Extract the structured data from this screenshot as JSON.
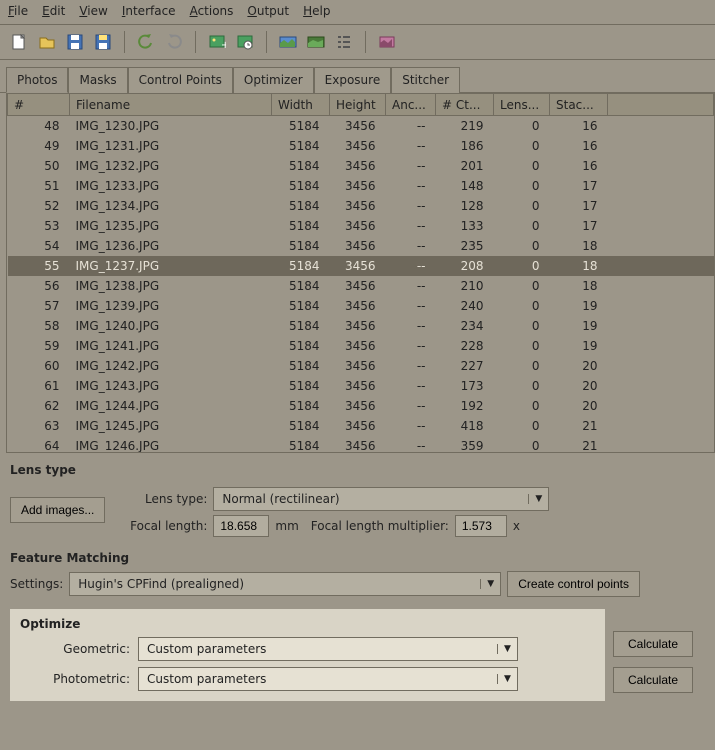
{
  "menu": {
    "file": "File",
    "edit": "Edit",
    "view": "View",
    "interface": "Interface",
    "actions": "Actions",
    "output": "Output",
    "help": "Help"
  },
  "tabs": {
    "photos": "Photos",
    "masks": "Masks",
    "controlpoints": "Control Points",
    "optimizer": "Optimizer",
    "exposure": "Exposure",
    "stitcher": "Stitcher"
  },
  "columns": {
    "num": "#",
    "filename": "Filename",
    "width": "Width",
    "height": "Height",
    "anc": "Anc...",
    "ct": "#  Ct...",
    "lens": "Lens...",
    "stac": "Stac..."
  },
  "rows": [
    {
      "n": "48",
      "f": "IMG_1230.JPG",
      "w": "5184",
      "h": "3456",
      "a": "--",
      "c": "219",
      "l": "0",
      "s": "16"
    },
    {
      "n": "49",
      "f": "IMG_1231.JPG",
      "w": "5184",
      "h": "3456",
      "a": "--",
      "c": "186",
      "l": "0",
      "s": "16"
    },
    {
      "n": "50",
      "f": "IMG_1232.JPG",
      "w": "5184",
      "h": "3456",
      "a": "--",
      "c": "201",
      "l": "0",
      "s": "16"
    },
    {
      "n": "51",
      "f": "IMG_1233.JPG",
      "w": "5184",
      "h": "3456",
      "a": "--",
      "c": "148",
      "l": "0",
      "s": "17"
    },
    {
      "n": "52",
      "f": "IMG_1234.JPG",
      "w": "5184",
      "h": "3456",
      "a": "--",
      "c": "128",
      "l": "0",
      "s": "17"
    },
    {
      "n": "53",
      "f": "IMG_1235.JPG",
      "w": "5184",
      "h": "3456",
      "a": "--",
      "c": "133",
      "l": "0",
      "s": "17"
    },
    {
      "n": "54",
      "f": "IMG_1236.JPG",
      "w": "5184",
      "h": "3456",
      "a": "--",
      "c": "235",
      "l": "0",
      "s": "18"
    },
    {
      "n": "55",
      "f": "IMG_1237.JPG",
      "w": "5184",
      "h": "3456",
      "a": "--",
      "c": "208",
      "l": "0",
      "s": "18",
      "sel": true
    },
    {
      "n": "56",
      "f": "IMG_1238.JPG",
      "w": "5184",
      "h": "3456",
      "a": "--",
      "c": "210",
      "l": "0",
      "s": "18"
    },
    {
      "n": "57",
      "f": "IMG_1239.JPG",
      "w": "5184",
      "h": "3456",
      "a": "--",
      "c": "240",
      "l": "0",
      "s": "19"
    },
    {
      "n": "58",
      "f": "IMG_1240.JPG",
      "w": "5184",
      "h": "3456",
      "a": "--",
      "c": "234",
      "l": "0",
      "s": "19"
    },
    {
      "n": "59",
      "f": "IMG_1241.JPG",
      "w": "5184",
      "h": "3456",
      "a": "--",
      "c": "228",
      "l": "0",
      "s": "19"
    },
    {
      "n": "60",
      "f": "IMG_1242.JPG",
      "w": "5184",
      "h": "3456",
      "a": "--",
      "c": "227",
      "l": "0",
      "s": "20"
    },
    {
      "n": "61",
      "f": "IMG_1243.JPG",
      "w": "5184",
      "h": "3456",
      "a": "--",
      "c": "173",
      "l": "0",
      "s": "20"
    },
    {
      "n": "62",
      "f": "IMG_1244.JPG",
      "w": "5184",
      "h": "3456",
      "a": "--",
      "c": "192",
      "l": "0",
      "s": "20"
    },
    {
      "n": "63",
      "f": "IMG_1245.JPG",
      "w": "5184",
      "h": "3456",
      "a": "--",
      "c": "418",
      "l": "0",
      "s": "21"
    },
    {
      "n": "64",
      "f": "IMG_1246.JPG",
      "w": "5184",
      "h": "3456",
      "a": "--",
      "c": "359",
      "l": "0",
      "s": "21"
    }
  ],
  "lens": {
    "section": "Lens type",
    "add_images": "Add images...",
    "type_label": "Lens type:",
    "type_value": "Normal (rectilinear)",
    "focal_label": "Focal length:",
    "focal_value": "18.658",
    "focal_unit": "mm",
    "mult_label": "Focal length multiplier:",
    "mult_value": "1.573",
    "mult_unit": "x"
  },
  "featmatch": {
    "section": "Feature Matching",
    "settings_label": "Settings:",
    "settings_value": "Hugin's CPFind (prealigned)",
    "create_cp": "Create control points"
  },
  "optimize": {
    "section": "Optimize",
    "geo_label": "Geometric:",
    "geo_value": "Custom parameters",
    "photo_label": "Photometric:",
    "photo_value": "Custom parameters",
    "calculate": "Calculate"
  }
}
